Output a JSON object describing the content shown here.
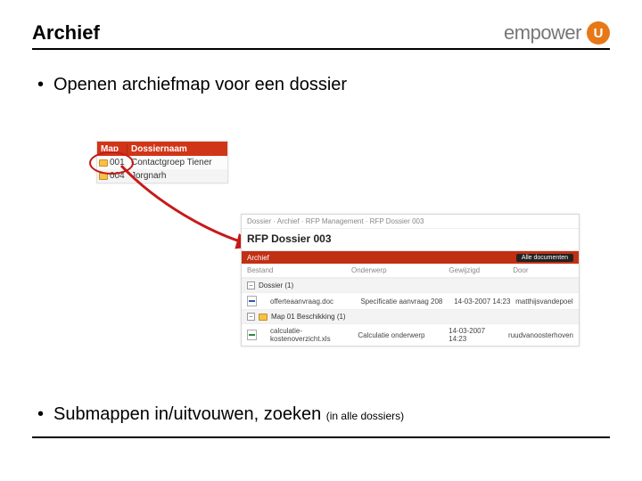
{
  "header": {
    "title": "Archief",
    "logo_text_light": "empower",
    "logo_badge": "U"
  },
  "bullets": {
    "b1": "Openen archiefmap voor een dossier",
    "b2_main": "Submappen in/uitvouwen, zoeken ",
    "b2_small": "(in alle dossiers)"
  },
  "folder_panel": {
    "col1": "Map",
    "col2": "Dossiernaam",
    "rows": [
      {
        "id": "001",
        "name": "Contactgroep Tiener"
      },
      {
        "id": "004",
        "name": "Jorgnarh"
      }
    ]
  },
  "detail_panel": {
    "crumb": "Dossier · Archief · RFP Management · RFP Dossier 003",
    "title": "RFP Dossier 003",
    "bar_left": "Archief",
    "bar_pill": "Alle documenten",
    "cols": [
      "Bestand",
      "Onderwerp",
      "Gewijzigd",
      "Door"
    ],
    "section1": "Dossier (1)",
    "row1": {
      "file": "offerteaanvraag.doc",
      "subject": "Specificatie aanvraag 208",
      "date": "14-03-2007 14:23",
      "by": "matthijsvandepoel"
    },
    "section2": "Map 01 Beschikking (1)",
    "row2": {
      "file": "calculatie-kostenoverzicht.xls",
      "subject": "Calculatie onderwerp",
      "date": "14-03-2007 14:23",
      "by": "ruudvanoosterhoven"
    }
  }
}
